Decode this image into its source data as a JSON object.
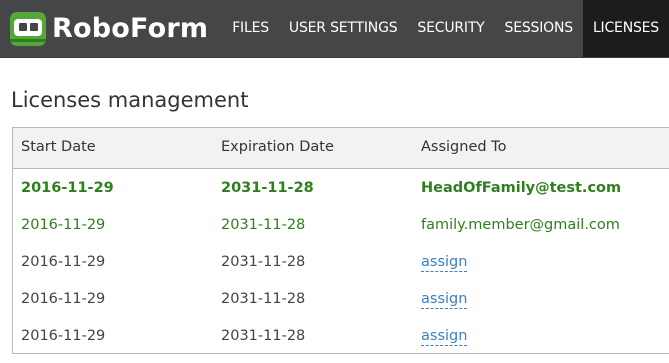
{
  "header": {
    "brand": "RoboForm",
    "nav": [
      "FILES",
      "USER SETTINGS",
      "SECURITY",
      "SESSIONS",
      "LICENSES"
    ],
    "active_index": 4
  },
  "page": {
    "title": "Licenses management"
  },
  "table": {
    "columns": [
      "Start Date",
      "Expiration Date",
      "Assigned To"
    ],
    "rows": [
      {
        "start": "2016-11-29",
        "expiration": "2031-11-28",
        "assigned": "HeadOfFamily@test.com",
        "style": "bold"
      },
      {
        "start": "2016-11-29",
        "expiration": "2031-11-28",
        "assigned": "family.member@gmail.com",
        "style": "green"
      },
      {
        "start": "2016-11-29",
        "expiration": "2031-11-28",
        "assigned": "assign",
        "style": "link"
      },
      {
        "start": "2016-11-29",
        "expiration": "2031-11-28",
        "assigned": "assign",
        "style": "link"
      },
      {
        "start": "2016-11-29",
        "expiration": "2031-11-28",
        "assigned": "assign",
        "style": "link"
      }
    ]
  },
  "colors": {
    "topbar": "#454647",
    "active_tab": "#1c1c1c",
    "brand_green": "#56a63a",
    "assigned_green": "#2f7f1f",
    "link_blue": "#3b7fc4"
  }
}
